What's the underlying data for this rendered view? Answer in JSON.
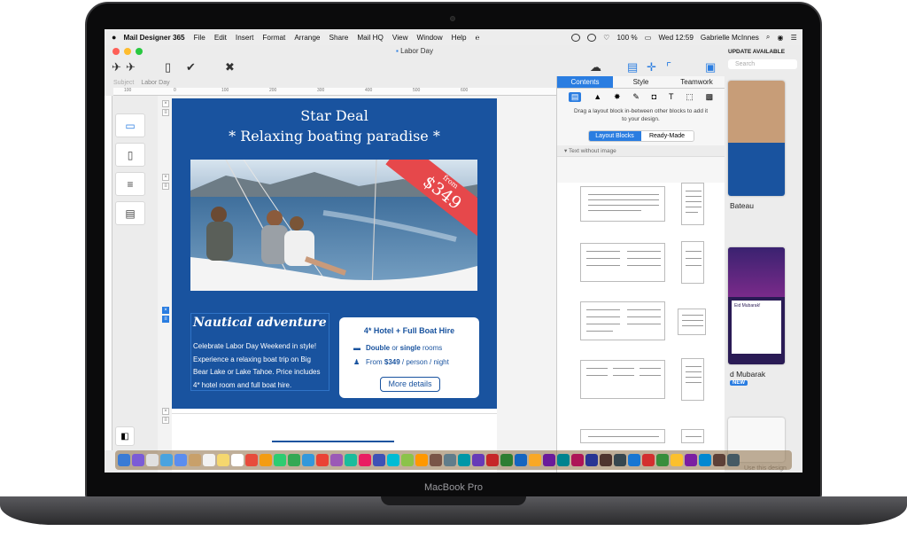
{
  "device": {
    "brand": "MacBook Pro"
  },
  "menubar": {
    "apple": "",
    "app": "Mail Designer 365",
    "items": [
      "File",
      "Edit",
      "Insert",
      "Format",
      "Arrange",
      "Share",
      "Mail HQ",
      "View",
      "Window",
      "Help"
    ],
    "battery": "100 %",
    "clock": "Wed 12:59",
    "user": "Gabrielle McInnes"
  },
  "window": {
    "title": "Labor Day"
  },
  "subject": {
    "label": "Subject",
    "value": "Labor Day"
  },
  "ruler": {
    "ticks": [
      "100",
      "0",
      "100",
      "200",
      "300",
      "400",
      "500",
      "600"
    ]
  },
  "email": {
    "hero_title": "Star Deal",
    "hero_subtitle": "* Relaxing boating paradise *",
    "ribbon_from": "from",
    "ribbon_price": "$349",
    "section_title": "Nautical adventure",
    "body_lines": [
      "Celebrate Labor Day Weekend in style!",
      "Experience a relaxing boat trip on Big",
      "Bear Lake or Lake Tahoe. Price includes",
      "4* hotel room and full boat hire."
    ],
    "card": {
      "title": "4* Hotel + Full Boat Hire",
      "row1_a": "Double",
      "row1_b": " or ",
      "row1_c": "single",
      "row1_d": " rooms",
      "row2_a": "From ",
      "row2_b": "$349",
      "row2_c": " / person / night",
      "button": "More details"
    }
  },
  "panel": {
    "tabs": [
      "Contents",
      "Style",
      "Teamwork"
    ],
    "hint": "Drag a layout block in-between other blocks to add it to your design.",
    "segments": [
      "Layout Blocks",
      "Ready-Made"
    ],
    "section": "Text without image"
  },
  "right_bar": {
    "update": "UPDATE AVAILABLE",
    "search_placeholder": "Search",
    "thumb1_label": "Bateau",
    "thumb2_label": "d Mubarak",
    "new_badge": "NEW",
    "thumb2_heading": "Eid Mubarak!",
    "use_design": "Use this design"
  },
  "colors": {
    "email_blue": "#19539f",
    "accent": "#2a7de1",
    "ribbon_red": "#e6484b"
  }
}
